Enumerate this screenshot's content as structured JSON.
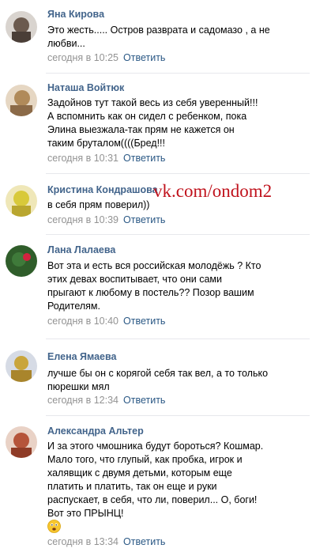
{
  "watermark": "vk.com/ondom2",
  "reply_label": "Ответить",
  "comments": [
    {
      "author": "Яна Кирова",
      "text": "Это жесть..... Остров разврата и садомазо , а не\nлюбви...",
      "time": "сегодня в 10:25",
      "avatar_color": "#6b5a4e"
    },
    {
      "author": "Наташа Войтюк",
      "text": "Задойнов тут такой весь из себя уверенный!!!\nА вспомнить как он сидел с ребенком, пока\nЭлина выезжала-так прям не кажется он\nтаким бруталом((((Бред!!!",
      "time": "сегодня в 10:31",
      "avatar_color": "#b08a5a"
    },
    {
      "author": "Кристина Кондрашова",
      "text": "в себя прям поверил))",
      "time": "сегодня в 10:39",
      "avatar_color": "#d8c93a"
    },
    {
      "author": "Лана Лалаева",
      "text": "Вот эта и есть вся российская молодёжь ? Кто\nэтих девах воспитывает, что они сами\nпрыгают к любому в постель?? Позор вашим\nРодителям.",
      "time": "сегодня в 10:40",
      "avatar_color": "#3f7a3a"
    },
    {
      "author": "Елена Ямаева",
      "text": "лучше бы он с корягой себя так вел, а то только\nпюрешки мял",
      "time": "сегодня в 12:34",
      "avatar_color": "#c9a53c"
    },
    {
      "author": "Александра Альтер",
      "text": "И за этого чмошника будут бороться? Кошмар.\nМало того, что глупый, как пробка, игрок и\nхалявщик с двумя детьми, которым еще\nплатить и платить, так он еще и руки\nраспускает, в себя, что ли, поверил... О, боги!\nВот это ПРЫНЦ!",
      "time": "сегодня в 13:34",
      "avatar_color": "#b5543a"
    }
  ]
}
